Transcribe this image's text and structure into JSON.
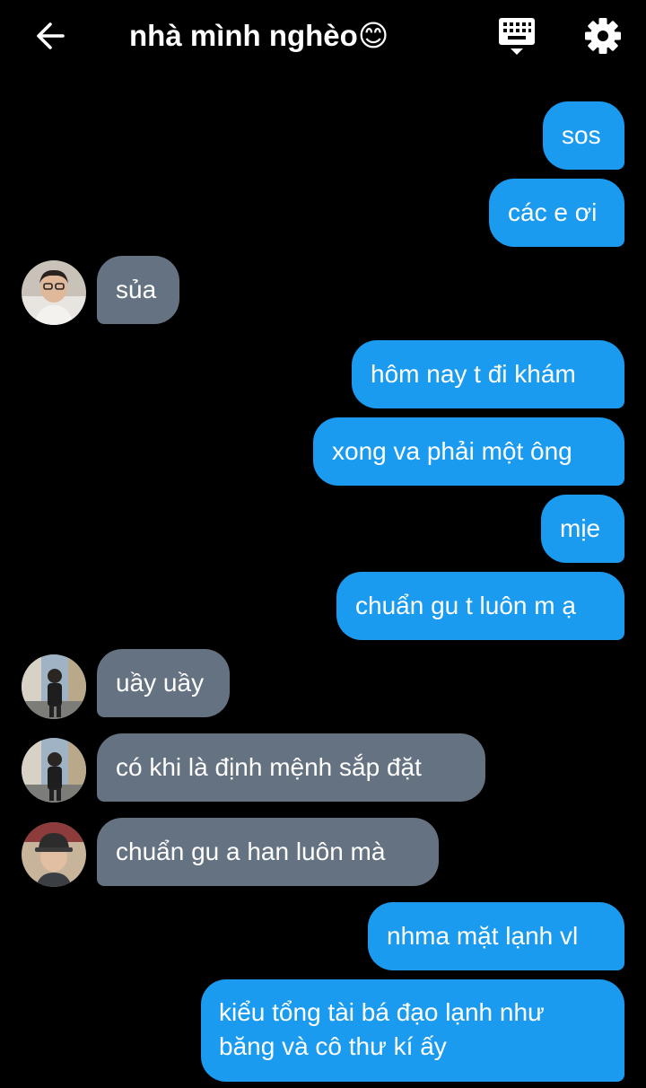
{
  "header": {
    "title": "nhà mình nghèo😊",
    "back_icon": "arrow-left-icon",
    "keyboard_icon": "keyboard-icon",
    "settings_icon": "gear-icon"
  },
  "colors": {
    "background": "#000000",
    "outgoing_bubble": "#1a9bf0",
    "incoming_bubble": "#657281",
    "text": "#ffffff"
  },
  "messages": [
    {
      "direction": "out",
      "text": "sos"
    },
    {
      "direction": "out",
      "text": "các e ơi"
    },
    {
      "direction": "in",
      "text": "sủa",
      "avatar": "avatar-person-glasses"
    },
    {
      "direction": "out",
      "text": "hôm nay t đi khám"
    },
    {
      "direction": "out",
      "text": "xong va phải một ông"
    },
    {
      "direction": "out",
      "text": "mịe"
    },
    {
      "direction": "out",
      "text": "chuẩn gu t luôn m ạ"
    },
    {
      "direction": "in",
      "text": "uầy uầy",
      "avatar": "avatar-person-street"
    },
    {
      "direction": "in",
      "text": "có khi là định mệnh sắp đặt",
      "avatar": "avatar-person-street"
    },
    {
      "direction": "in",
      "text": "chuẩn gu a han luôn mà",
      "avatar": "avatar-person-cap"
    },
    {
      "direction": "out",
      "text": "nhma mặt lạnh vl"
    },
    {
      "direction": "out",
      "text": "kiểu tổng tài bá đạo lạnh như băng và cô thư kí ấy"
    }
  ]
}
